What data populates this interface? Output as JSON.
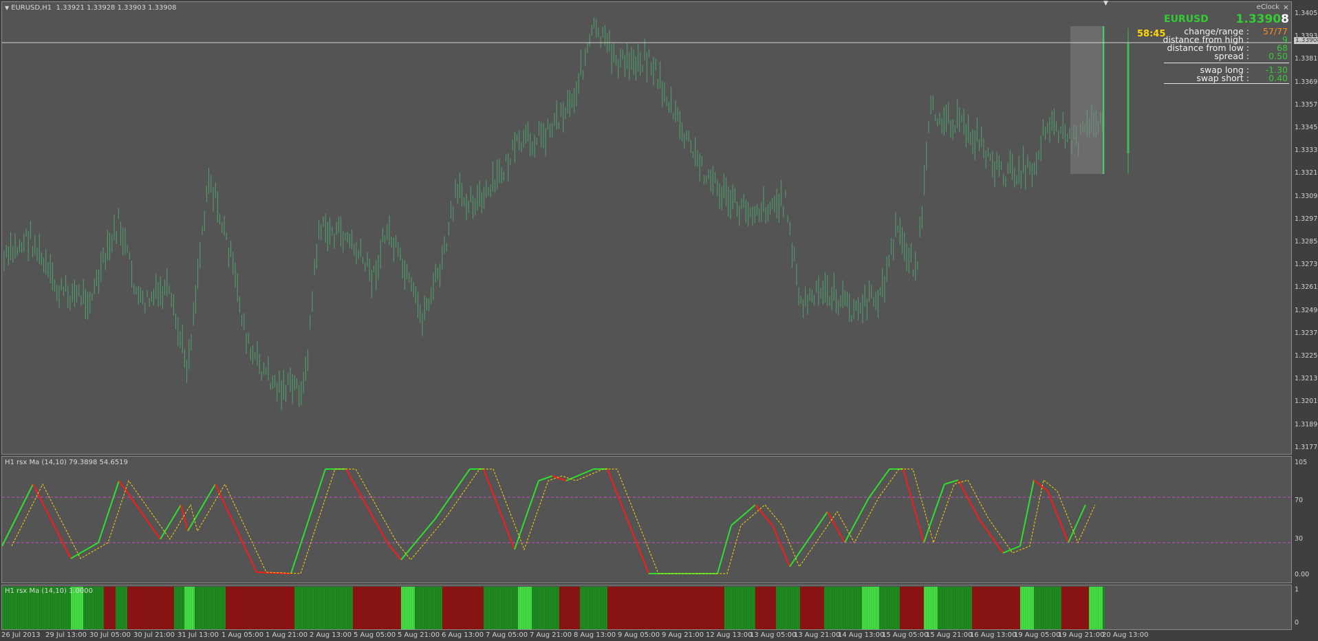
{
  "window": {
    "title": "EURUSD,H1",
    "ohlc": "1.33921 1.33928 1.33903 1.33908"
  },
  "price_axis": [
    "1.34050",
    "1.33930",
    "1.33810",
    "1.33690",
    "1.33570",
    "1.33450",
    "1.33330",
    "1.33210",
    "1.33090",
    "1.32970",
    "1.32850",
    "1.32730",
    "1.32610",
    "1.32490",
    "1.32370",
    "1.32250",
    "1.32130",
    "1.32010",
    "1.31890",
    "1.31770"
  ],
  "price_tag": "1.33908",
  "timer": "58:45",
  "eclock": {
    "title": "eClock",
    "close_label": "×",
    "symbol": "EURUSD",
    "price_main": "1.3390",
    "price_last_digit": "8",
    "rows": [
      {
        "label": "change/range :",
        "value": "57/77",
        "color": "#ff8c1a"
      },
      {
        "label": "distance from high :",
        "value": "9",
        "color": "#33cc33"
      },
      {
        "label": "distance from low :",
        "value": "68",
        "color": "#33cc33"
      },
      {
        "label": "spread :",
        "value": "0.50",
        "color": "#33cc33"
      },
      {
        "label": "swap long :",
        "value": "-1.30",
        "color": "#33cc33"
      },
      {
        "label": "swap short :",
        "value": "0.40",
        "color": "#33cc33"
      }
    ]
  },
  "oscillator": {
    "title": "H1 rsx Ma (14,10) 79.3898 54.6519",
    "axis": [
      "105",
      "70",
      "30",
      "0.00"
    ],
    "up_color": "#2ee02e",
    "down_color": "#ff1a1a",
    "signal_color": "#ffd700",
    "level_color": "#c050c0"
  },
  "bars": {
    "title": "H1 rsx Ma (14,10) 1.0000",
    "axis": [
      "1",
      "0"
    ],
    "green": "#1f8a1f",
    "bright": "#44dd44",
    "red": "#8e1414"
  },
  "time_axis": [
    "26 Jul 2013",
    "29 Jul 13:00",
    "30 Jul 05:00",
    "30 Jul 21:00",
    "31 Jul 13:00",
    "1 Aug 05:00",
    "1 Aug 21:00",
    "2 Aug 13:00",
    "5 Aug 05:00",
    "5 Aug 21:00",
    "6 Aug 13:00",
    "7 Aug 05:00",
    "7 Aug 21:00",
    "8 Aug 13:00",
    "9 Aug 05:00",
    "9 Aug 21:00",
    "12 Aug 13:00",
    "13 Aug 05:00",
    "13 Aug 21:00",
    "14 Aug 13:00",
    "15 Aug 05:00",
    "15 Aug 21:00",
    "16 Aug 13:00",
    "19 Aug 05:00",
    "19 Aug 21:00",
    "20 Aug 13:00"
  ],
  "colors": {
    "background": "#545454",
    "candle": "#4fa56f",
    "current_candle": "#3dbd56"
  }
}
